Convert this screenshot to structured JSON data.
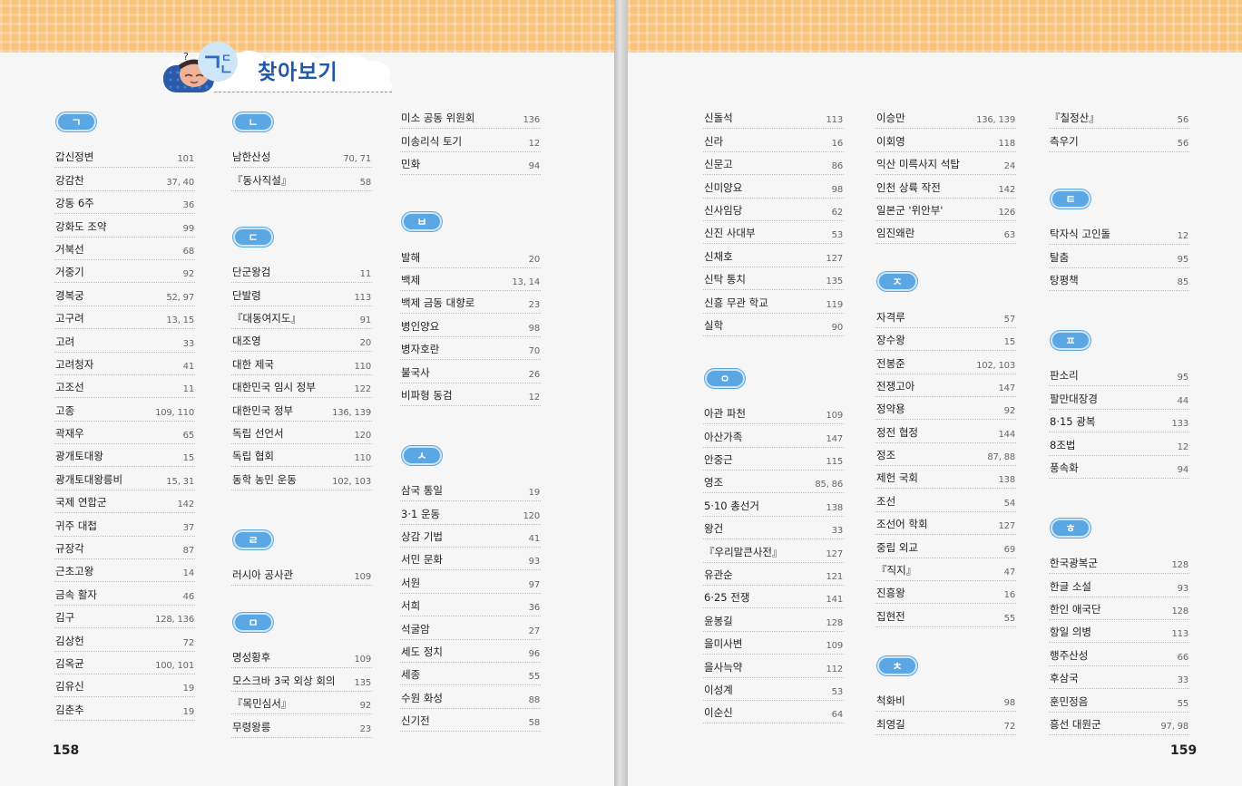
{
  "title": "찾아보기",
  "left_page_number": "158",
  "right_page_number": "159",
  "colors": {
    "accent_blue": "#5aa7e3",
    "title_blue": "#1f58a8",
    "band_orange": "#f7c27a"
  },
  "icons": [
    "character-mascot-icon"
  ],
  "groups": [
    {
      "letter": "ㄱ",
      "entries": [
        {
          "term": "갑신정변",
          "pages": "101"
        },
        {
          "term": "강감찬",
          "pages": "37, 40"
        },
        {
          "term": "강동 6주",
          "pages": "36"
        },
        {
          "term": "강화도 조약",
          "pages": "99"
        },
        {
          "term": "거북선",
          "pages": "68"
        },
        {
          "term": "거중기",
          "pages": "92"
        },
        {
          "term": "경복궁",
          "pages": "52, 97"
        },
        {
          "term": "고구려",
          "pages": "13, 15"
        },
        {
          "term": "고려",
          "pages": "33"
        },
        {
          "term": "고려청자",
          "pages": "41"
        },
        {
          "term": "고조선",
          "pages": "11"
        },
        {
          "term": "고종",
          "pages": "109, 110"
        },
        {
          "term": "곽재우",
          "pages": "65"
        },
        {
          "term": "광개토대왕",
          "pages": "15"
        },
        {
          "term": "광개토대왕릉비",
          "pages": "15, 31"
        },
        {
          "term": "국제 연합군",
          "pages": "142"
        },
        {
          "term": "귀주 대첩",
          "pages": "37"
        },
        {
          "term": "규장각",
          "pages": "87"
        },
        {
          "term": "근초고왕",
          "pages": "14"
        },
        {
          "term": "금속 활자",
          "pages": "46"
        },
        {
          "term": "김구",
          "pages": "128, 136"
        },
        {
          "term": "김상헌",
          "pages": "72"
        },
        {
          "term": "김옥균",
          "pages": "100, 101"
        },
        {
          "term": "김유신",
          "pages": "19"
        },
        {
          "term": "김춘추",
          "pages": "19"
        }
      ]
    },
    {
      "letter": "ㄴ",
      "entries": [
        {
          "term": "남한산성",
          "pages": "70, 71"
        },
        {
          "term": "『동사직설』",
          "pages": "58"
        }
      ]
    },
    {
      "letter": "ㄷ",
      "entries": [
        {
          "term": "단군왕검",
          "pages": "11"
        },
        {
          "term": "단발령",
          "pages": "113"
        },
        {
          "term": "『대동여지도』",
          "pages": "91"
        },
        {
          "term": "대조영",
          "pages": "20"
        },
        {
          "term": "대한 제국",
          "pages": "110"
        },
        {
          "term": "대한민국 임시 정부",
          "pages": "122"
        },
        {
          "term": "대한민국 정부",
          "pages": "136, 139"
        },
        {
          "term": "독립 선언서",
          "pages": "120"
        },
        {
          "term": "독립 협회",
          "pages": "110"
        },
        {
          "term": "동학 농민 운동",
          "pages": "102, 103"
        }
      ]
    },
    {
      "letter": "ㄹ",
      "entries": [
        {
          "term": "러시아 공사관",
          "pages": "109"
        }
      ]
    },
    {
      "letter": "ㅁ",
      "entries": [
        {
          "term": "명성황후",
          "pages": "109"
        },
        {
          "term": "모스크바 3국 외상 회의",
          "pages": "135"
        },
        {
          "term": "『목민심서』",
          "pages": "92"
        },
        {
          "term": "무령왕릉",
          "pages": "23"
        }
      ]
    },
    {
      "letter": "",
      "entries": [
        {
          "term": "미소 공동 위원회",
          "pages": "136"
        },
        {
          "term": "미송리식 토기",
          "pages": "12"
        },
        {
          "term": "민화",
          "pages": "94"
        }
      ]
    },
    {
      "letter": "ㅂ",
      "entries": [
        {
          "term": "발해",
          "pages": "20"
        },
        {
          "term": "백제",
          "pages": "13, 14"
        },
        {
          "term": "백제 금동 대향로",
          "pages": "23"
        },
        {
          "term": "병인양요",
          "pages": "98"
        },
        {
          "term": "병자호란",
          "pages": "70"
        },
        {
          "term": "불국사",
          "pages": "26"
        },
        {
          "term": "비파형 동검",
          "pages": "12"
        }
      ]
    },
    {
      "letter": "ㅅ",
      "entries": [
        {
          "term": "삼국 통일",
          "pages": "19"
        },
        {
          "term": "3·1 운동",
          "pages": "120"
        },
        {
          "term": "상감 기법",
          "pages": "41"
        },
        {
          "term": "서민 문화",
          "pages": "93"
        },
        {
          "term": "서원",
          "pages": "97"
        },
        {
          "term": "서희",
          "pages": "36"
        },
        {
          "term": "석굴암",
          "pages": "27"
        },
        {
          "term": "세도 정치",
          "pages": "96"
        },
        {
          "term": "세종",
          "pages": "55"
        },
        {
          "term": "수원 화성",
          "pages": "88"
        },
        {
          "term": "신기전",
          "pages": "58"
        }
      ]
    },
    {
      "letter": "",
      "entries": [
        {
          "term": "신돌석",
          "pages": "113"
        },
        {
          "term": "신라",
          "pages": "16"
        },
        {
          "term": "신문고",
          "pages": "86"
        },
        {
          "term": "신미양요",
          "pages": "98"
        },
        {
          "term": "신사임당",
          "pages": "62"
        },
        {
          "term": "신진 사대부",
          "pages": "53"
        },
        {
          "term": "신채호",
          "pages": "127"
        },
        {
          "term": "신탁 통치",
          "pages": "135"
        },
        {
          "term": "신흥 무관 학교",
          "pages": "119"
        },
        {
          "term": "실학",
          "pages": "90"
        }
      ]
    },
    {
      "letter": "ㅇ",
      "entries": [
        {
          "term": "아관 파천",
          "pages": "109"
        },
        {
          "term": "아산가족",
          "pages": "147"
        },
        {
          "term": "안중근",
          "pages": "115"
        },
        {
          "term": "영조",
          "pages": "85, 86"
        },
        {
          "term": "5·10 총선거",
          "pages": "138"
        },
        {
          "term": "왕건",
          "pages": "33"
        },
        {
          "term": "『우리말큰사전』",
          "pages": "127"
        },
        {
          "term": "유관순",
          "pages": "121"
        },
        {
          "term": "6·25 전쟁",
          "pages": "141"
        },
        {
          "term": "윤봉길",
          "pages": "128"
        },
        {
          "term": "을미사변",
          "pages": "109"
        },
        {
          "term": "을사늑약",
          "pages": "112"
        },
        {
          "term": "이성계",
          "pages": "53"
        },
        {
          "term": "이순신",
          "pages": "64"
        }
      ]
    },
    {
      "letter": "",
      "entries": [
        {
          "term": "이승만",
          "pages": "136, 139"
        },
        {
          "term": "이회영",
          "pages": "118"
        },
        {
          "term": "익산 미륵사지 석탑",
          "pages": "24"
        },
        {
          "term": "인천 상륙 작전",
          "pages": "142"
        },
        {
          "term": "일본군 '위안부'",
          "pages": "126"
        },
        {
          "term": "임진왜란",
          "pages": "63"
        }
      ]
    },
    {
      "letter": "ㅈ",
      "entries": [
        {
          "term": "자격루",
          "pages": "57"
        },
        {
          "term": "장수왕",
          "pages": "15"
        },
        {
          "term": "전봉준",
          "pages": "102, 103"
        },
        {
          "term": "전쟁고아",
          "pages": "147"
        },
        {
          "term": "정약용",
          "pages": "92"
        },
        {
          "term": "정전 협정",
          "pages": "144"
        },
        {
          "term": "정조",
          "pages": "87, 88"
        },
        {
          "term": "제헌 국회",
          "pages": "138"
        },
        {
          "term": "조선",
          "pages": "54"
        },
        {
          "term": "조선어 학회",
          "pages": "127"
        },
        {
          "term": "중립 외교",
          "pages": "69"
        },
        {
          "term": "『직지』",
          "pages": "47"
        },
        {
          "term": "진흥왕",
          "pages": "16"
        },
        {
          "term": "집현전",
          "pages": "55"
        }
      ]
    },
    {
      "letter": "ㅊ",
      "entries": [
        {
          "term": "척화비",
          "pages": "98"
        },
        {
          "term": "최영길",
          "pages": "72"
        }
      ]
    },
    {
      "letter": "",
      "entries": [
        {
          "term": "『칠정산』",
          "pages": "56"
        },
        {
          "term": "측우기",
          "pages": "56"
        }
      ]
    },
    {
      "letter": "ㅌ",
      "entries": [
        {
          "term": "탁자식 고인돌",
          "pages": "12"
        },
        {
          "term": "탈춤",
          "pages": "95"
        },
        {
          "term": "탕평책",
          "pages": "85"
        }
      ]
    },
    {
      "letter": "ㅍ",
      "entries": [
        {
          "term": "판소리",
          "pages": "95"
        },
        {
          "term": "팔만대장경",
          "pages": "44"
        },
        {
          "term": "8·15 광복",
          "pages": "133"
        },
        {
          "term": "8조법",
          "pages": "12"
        },
        {
          "term": "풍속화",
          "pages": "94"
        }
      ]
    },
    {
      "letter": "ㅎ",
      "entries": [
        {
          "term": "한국광복군",
          "pages": "128"
        },
        {
          "term": "한글 소설",
          "pages": "93"
        },
        {
          "term": "한인 애국단",
          "pages": "128"
        },
        {
          "term": "항일 의병",
          "pages": "113"
        },
        {
          "term": "행주산성",
          "pages": "66"
        },
        {
          "term": "후삼국",
          "pages": "33"
        },
        {
          "term": "훈민정음",
          "pages": "55"
        },
        {
          "term": "흥선 대원군",
          "pages": "97, 98"
        }
      ]
    }
  ]
}
